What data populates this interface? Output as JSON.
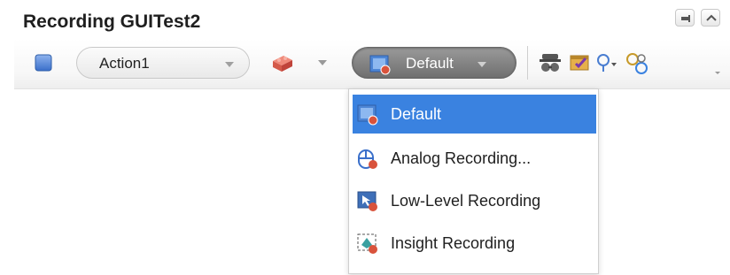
{
  "window": {
    "title": "Recording GUITest2",
    "pin_icon": "pin-icon",
    "collapse_icon": "chevron-up-icon"
  },
  "toolbar": {
    "stop_icon": "stop-icon",
    "action_selector": {
      "value": "Action1"
    },
    "object_icon": "brick-icon",
    "recording_mode": {
      "value": "Default"
    },
    "icons": [
      "spy-icon",
      "checkpoint-icon",
      "lightbulb-icon",
      "synchronize-icon"
    ]
  },
  "recording_mode_menu": {
    "items": [
      {
        "label": "Default",
        "icon": "default-recording-icon",
        "selected": true
      },
      {
        "label": "Analog Recording...",
        "icon": "analog-recording-icon",
        "selected": false
      },
      {
        "label": "Low-Level Recording",
        "icon": "low-level-recording-icon",
        "selected": false
      },
      {
        "label": "Insight Recording",
        "icon": "insight-recording-icon",
        "selected": false
      }
    ]
  },
  "colors": {
    "selection": "#3a82e0",
    "stop_blue": "#4a7ed1",
    "record_red": "#d9533c"
  }
}
